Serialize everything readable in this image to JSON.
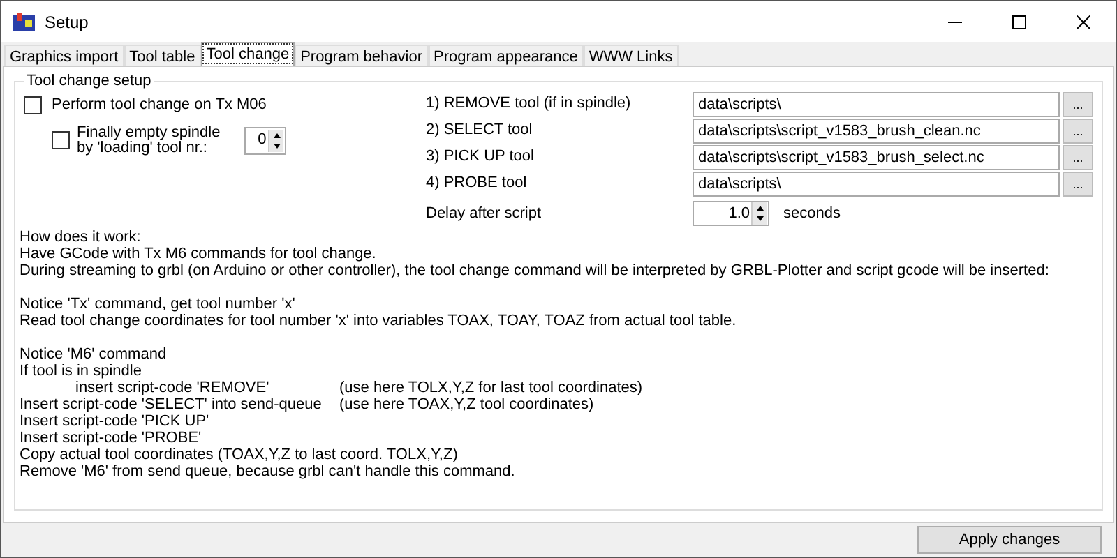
{
  "window": {
    "title": "Setup"
  },
  "tabs": [
    {
      "label": "Graphics import",
      "selected": false
    },
    {
      "label": "Tool table",
      "selected": false
    },
    {
      "label": "Tool change",
      "selected": true
    },
    {
      "label": "Program behavior",
      "selected": false
    },
    {
      "label": "Program appearance",
      "selected": false
    },
    {
      "label": "WWW Links",
      "selected": false
    }
  ],
  "group": {
    "title": "Tool change setup",
    "perform": {
      "label": "Perform tool change on Tx M06",
      "checked": false
    },
    "empty_spindle": {
      "label_lines": [
        "Finally empty spindle",
        "by 'loading' tool nr.:"
      ],
      "checked": false,
      "value": "0"
    },
    "scripts": [
      {
        "label": "1) REMOVE tool (if in spindle)",
        "value": "data\\scripts\\",
        "button": "..."
      },
      {
        "label": "2) SELECT tool",
        "value": "data\\scripts\\script_v1583_brush_clean.nc",
        "button": "..."
      },
      {
        "label": "3) PICK UP tool",
        "value": "data\\scripts\\script_v1583_brush_select.nc",
        "button": "..."
      },
      {
        "label": "4) PROBE tool",
        "value": "data\\scripts\\",
        "button": "..."
      }
    ],
    "delay": {
      "label": "Delay after script",
      "value": "1.0",
      "unit": "seconds"
    },
    "help": [
      [
        {
          "text": "How does it work:"
        },
        {
          "text": "Have GCode with Tx M6 commands for tool change."
        },
        {
          "text": "During streaming to grbl (on Arduino or other controller), the tool change command will be interpreted by GRBL-Plotter and script gcode will be inserted:"
        }
      ],
      [
        {
          "text": "Notice 'Tx' command, get tool number 'x'"
        },
        {
          "text": "Read tool change coordinates for tool number 'x' into variables TOAX, TOAY, TOAZ from actual tool table."
        }
      ],
      [
        {
          "text": "Notice 'M6' command"
        },
        {
          "text": "If tool is in spindle"
        },
        {
          "text": "insert script-code 'REMOVE'",
          "indent": true,
          "note": "(use here TOLX,Y,Z for last tool coordinates)"
        },
        {
          "text": "Insert script-code 'SELECT' into send-queue",
          "note": "(use here TOAX,Y,Z tool coordinates)"
        },
        {
          "text": "Insert script-code 'PICK UP'"
        },
        {
          "text": "Insert script-code 'PROBE'"
        },
        {
          "text": "Copy actual tool coordinates (TOAX,Y,Z to last coord. TOLX,Y,Z)"
        },
        {
          "text": "Remove 'M6' from send queue, because grbl can't handle this command."
        }
      ]
    ]
  },
  "apply_button": "Apply changes"
}
